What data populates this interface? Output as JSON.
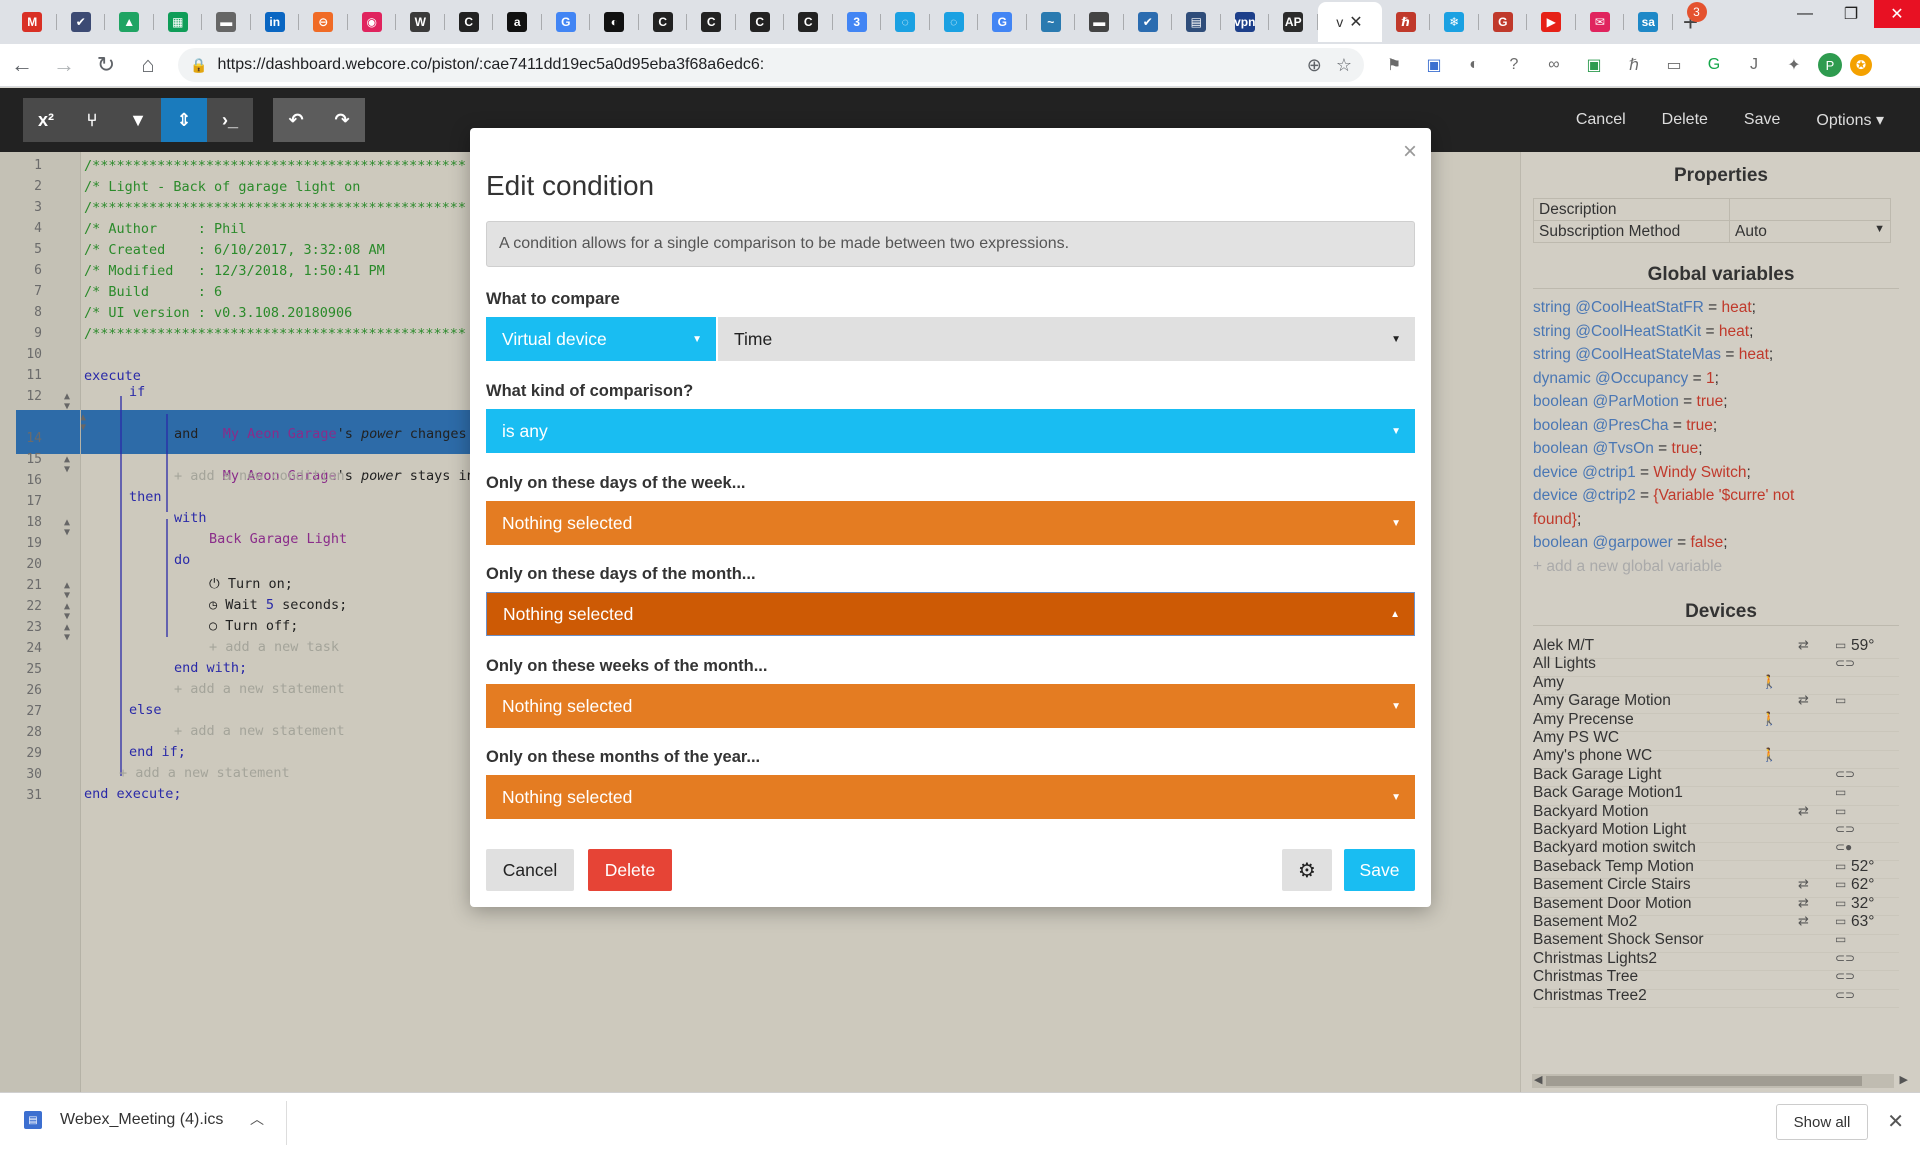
{
  "browser": {
    "url": "https://dashboard.webcore.co/piston/:cae7411dd19ec5a0d95eba3f68a6edc6:",
    "new_tab_badge": "3",
    "active_tab_label": "v",
    "tab_favicons": [
      {
        "glyph": "M",
        "color": "#d93025"
      },
      {
        "glyph": "✔",
        "color": "#3c4a73"
      },
      {
        "glyph": "▲",
        "color": "#1fa463"
      },
      {
        "glyph": "▦",
        "color": "#0f9d58"
      },
      {
        "glyph": "▬",
        "color": "#666666"
      },
      {
        "glyph": "in",
        "color": "#0a66c2"
      },
      {
        "glyph": "⊖",
        "color": "#f06b26"
      },
      {
        "glyph": "◉",
        "color": "#e0245e"
      },
      {
        "glyph": "W",
        "color": "#3a3a3a"
      },
      {
        "glyph": "C",
        "color": "#222222"
      },
      {
        "glyph": "a",
        "color": "#111111"
      },
      {
        "glyph": "G",
        "color": "#4285f4"
      },
      {
        "glyph": "◐",
        "color": "#111111"
      },
      {
        "glyph": "C",
        "color": "#222222"
      },
      {
        "glyph": "C",
        "color": "#222222"
      },
      {
        "glyph": "C",
        "color": "#222222"
      },
      {
        "glyph": "C",
        "color": "#222222"
      },
      {
        "glyph": "3",
        "color": "#4285f4"
      },
      {
        "glyph": "◌",
        "color": "#1ba1e2"
      },
      {
        "glyph": "◌",
        "color": "#1ba1e2"
      },
      {
        "glyph": "G",
        "color": "#4285f4"
      },
      {
        "glyph": "~",
        "color": "#2a7ab0"
      },
      {
        "glyph": "▬",
        "color": "#444444"
      },
      {
        "glyph": "✔",
        "color": "#2b6cb0"
      },
      {
        "glyph": "▤",
        "color": "#2f4d7a"
      },
      {
        "glyph": "vpn",
        "color": "#1d3f8a"
      },
      {
        "glyph": "AP",
        "color": "#2b2b2b"
      }
    ],
    "tab_favicons_right": [
      {
        "glyph": "ℏ",
        "color": "#c0392b"
      },
      {
        "glyph": "❄",
        "color": "#1ba1e2"
      },
      {
        "glyph": "G",
        "color": "#c0392b"
      },
      {
        "glyph": "▶",
        "color": "#e62117"
      },
      {
        "glyph": "✉",
        "color": "#e0245e"
      },
      {
        "glyph": "sa",
        "color": "#1e88c7"
      }
    ],
    "profile_initial": "P"
  },
  "toolbar": {
    "cancel": "Cancel",
    "delete": "Delete",
    "save": "Save",
    "options": "Options"
  },
  "editor": {
    "line_numbers": [
      "1",
      "2",
      "3",
      "4",
      "5",
      "6",
      "7",
      "8",
      "9",
      "10",
      "11",
      "12",
      "13",
      "14",
      "15",
      "16",
      "17",
      "18",
      "19",
      "20",
      "21",
      "22",
      "23",
      "24",
      "25",
      "26",
      "27",
      "28",
      "29",
      "30",
      "31"
    ],
    "header_lines": [
      "/**********************************************",
      "/* Light - Back of garage light on",
      "/**********************************************",
      "/* Author     : Phil",
      "/* Created    : 6/10/2017, 3:32:08 AM",
      "/* Modified   : 12/3/2018, 1:50:41 PM",
      "/* Build      : 6",
      "/* UI version : v0.3.108.20180906",
      "/**********************************************"
    ],
    "kw_execute": "execute",
    "kw_if": "if",
    "cond1_device": "My Aeon Garage",
    "cond1_possessive": "'s ",
    "cond1_attr": "power",
    "cond1_tail": " changes",
    "kw_and": "and",
    "cond2_device": "My Aeon Garage",
    "cond2_possessive": "'s ",
    "cond2_attr": "power",
    "cond2_tail": " stays inside",
    "add_condition": "+ add a new condition",
    "kw_then": "then",
    "kw_with": "with",
    "with_device": "Back Garage Light",
    "kw_do": "do",
    "task1": "Turn on;",
    "task2_pre": "Wait ",
    "task2_num": "5",
    "task2_post": " seconds;",
    "task3": "Turn off;",
    "add_task": "+ add a new task",
    "end_with": "end with;",
    "add_statement": "+ add a new statement",
    "kw_else": "else",
    "end_if": "end if;",
    "end_execute": "end execute;"
  },
  "modal": {
    "title": "Edit condition",
    "description": "A condition allows for a single comparison to be made between two expressions.",
    "what_to_compare_label": "What to compare",
    "compare_type": "Virtual device",
    "compare_value": "Time",
    "comparison_label": "What kind of comparison?",
    "comparison_value": "is any",
    "days_week_label": "Only on these days of the week...",
    "days_week_value": "Nothing selected",
    "days_month_label": "Only on these days of the month...",
    "days_month_value": "Nothing selected",
    "weeks_month_label": "Only on these weeks of the month...",
    "weeks_month_value": "Nothing selected",
    "months_year_label": "Only on these months of the year...",
    "months_year_value": "Nothing selected",
    "cancel": "Cancel",
    "delete": "Delete",
    "save": "Save"
  },
  "properties": {
    "title": "Properties",
    "rows": [
      {
        "key": "Description",
        "value": ""
      },
      {
        "key": "Subscription Method",
        "value": "Auto"
      }
    ]
  },
  "globals": {
    "title": "Global variables",
    "items": [
      {
        "type": "string",
        "name": "@CoolHeatStatFR",
        "eq": " = ",
        "value": "heat",
        "end": ";"
      },
      {
        "type": "string",
        "name": "@CoolHeatStatKit",
        "eq": " = ",
        "value": "heat",
        "end": ";"
      },
      {
        "type": "string",
        "name": "@CoolHeatStateMas",
        "eq": " = ",
        "value": "heat",
        "end": ";"
      },
      {
        "type": "dynamic",
        "name": "@Occupancy",
        "eq": " = ",
        "value": "1",
        "end": ";"
      },
      {
        "type": "boolean",
        "name": "@ParMotion",
        "eq": " = ",
        "value": "true",
        "end": ";"
      },
      {
        "type": "boolean",
        "name": "@PresCha",
        "eq": " = ",
        "value": "true",
        "end": ";"
      },
      {
        "type": "boolean",
        "name": "@TvsOn",
        "eq": " = ",
        "value": "true",
        "end": ";"
      },
      {
        "type": "device",
        "name": "@ctrip1",
        "eq": " = ",
        "value": "Windy Switch",
        "end": ";"
      },
      {
        "type": "device",
        "name": "@ctrip2",
        "eq": " = ",
        "value": "{Variable '$curre' not",
        "end": ""
      },
      {
        "type": "",
        "name": "",
        "eq": "",
        "value": "found}",
        "end": ";"
      },
      {
        "type": "boolean",
        "name": "@garpower",
        "eq": " = ",
        "value": "false",
        "end": ";"
      }
    ],
    "add_label": "+ add a new global variable"
  },
  "devices": {
    "title": "Devices",
    "items": [
      {
        "name": "Alek M/T",
        "i1": "",
        "i2": "⇄",
        "i3": "▭",
        "temp": "59°"
      },
      {
        "name": "All Lights",
        "i1": "",
        "i2": "",
        "i3": "⊂⊃",
        "temp": ""
      },
      {
        "name": "Amy",
        "i1": "🚶",
        "i2": "",
        "i3": "",
        "temp": ""
      },
      {
        "name": "Amy Garage Motion",
        "i1": "",
        "i2": "⇄",
        "i3": "▭",
        "temp": ""
      },
      {
        "name": "Amy Precense",
        "i1": "🚶",
        "i2": "",
        "i3": "",
        "temp": ""
      },
      {
        "name": "Amy PS WC",
        "i1": "",
        "i2": "",
        "i3": "",
        "temp": ""
      },
      {
        "name": "Amy's phone WC",
        "i1": "🚶",
        "i2": "",
        "i3": "",
        "temp": ""
      },
      {
        "name": "Back Garage Light",
        "i1": "",
        "i2": "",
        "i3": "⊂⊃",
        "temp": ""
      },
      {
        "name": "Back Garage Motion1",
        "i1": "",
        "i2": "",
        "i3": "▭",
        "temp": ""
      },
      {
        "name": "Backyard Motion",
        "i1": "",
        "i2": "⇄",
        "i3": "▭",
        "temp": ""
      },
      {
        "name": "Backyard Motion Light",
        "i1": "",
        "i2": "",
        "i3": "⊂⊃",
        "temp": ""
      },
      {
        "name": "Backyard motion switch",
        "i1": "",
        "i2": "",
        "i3": "⊂●",
        "temp": ""
      },
      {
        "name": "Baseback Temp Motion",
        "i1": "",
        "i2": "",
        "i3": "▭",
        "temp": "52°"
      },
      {
        "name": "Basement Circle Stairs",
        "i1": "",
        "i2": "⇄",
        "i3": "▭",
        "temp": "62°"
      },
      {
        "name": "Basement Door Motion",
        "i1": "",
        "i2": "⇄",
        "i3": "▭",
        "temp": "32°"
      },
      {
        "name": "Basement Mo2",
        "i1": "",
        "i2": "⇄",
        "i3": "▭",
        "temp": "63°"
      },
      {
        "name": "Basement Shock Sensor",
        "i1": "",
        "i2": "",
        "i3": "▭",
        "temp": ""
      },
      {
        "name": "Christmas Lights2",
        "i1": "",
        "i2": "",
        "i3": "⊂⊃",
        "temp": ""
      },
      {
        "name": "Christmas Tree",
        "i1": "",
        "i2": "",
        "i3": "⊂⊃",
        "temp": ""
      },
      {
        "name": "Christmas Tree2",
        "i1": "",
        "i2": "",
        "i3": "⊂⊃",
        "temp": ""
      }
    ]
  },
  "downloads": {
    "file": "Webex_Meeting (4).ics",
    "show_all": "Show all"
  }
}
